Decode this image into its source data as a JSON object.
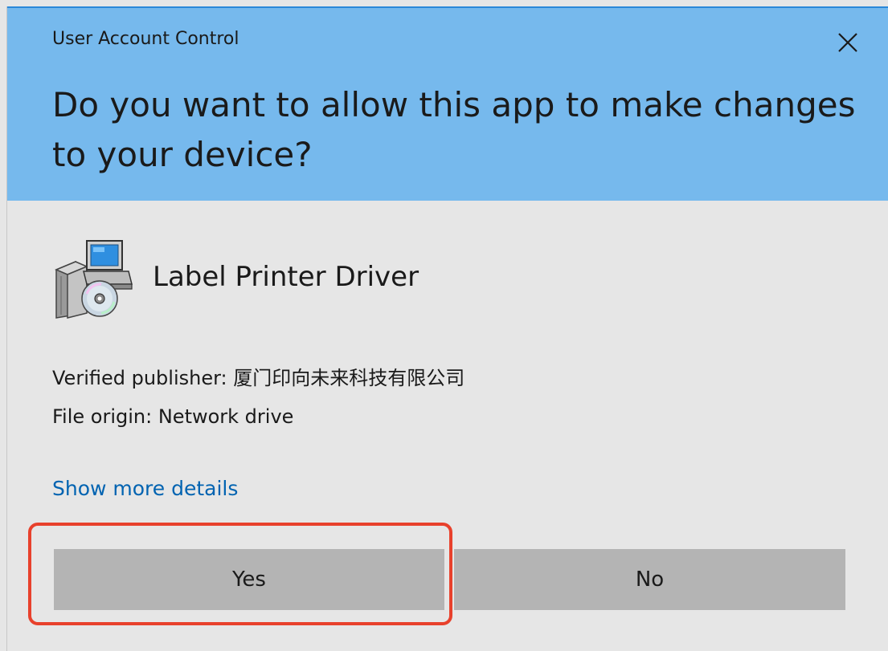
{
  "dialog": {
    "title": "User Account Control",
    "question": "Do you want to allow this app to make changes to your device?",
    "close_icon": "close-icon"
  },
  "app": {
    "icon": "installer-icon",
    "name": "Label Printer Driver"
  },
  "info": {
    "publisher_label": "Verified publisher: ",
    "publisher_value": "厦门印向未来科技有限公司",
    "origin_label": "File origin: ",
    "origin_value": "Network drive"
  },
  "details_link": "Show more details",
  "buttons": {
    "yes": "Yes",
    "no": "No"
  },
  "colors": {
    "header": "#76b9ed",
    "body": "#e6e6e6",
    "button": "#b4b4b4",
    "link": "#0063b1",
    "highlight": "#e8412c"
  }
}
